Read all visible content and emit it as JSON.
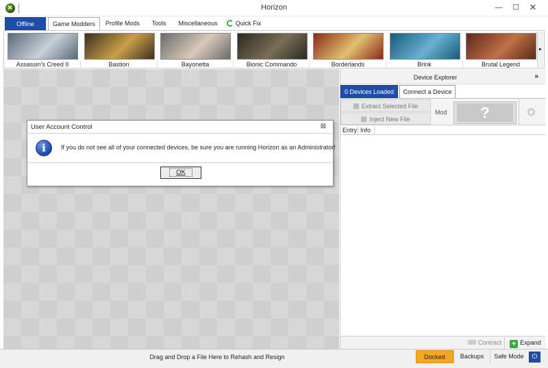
{
  "window": {
    "title": "Horizon",
    "min_glyph": "—",
    "max_glyph": "☐",
    "close_glyph": "✕"
  },
  "tabs": {
    "offline": "Offline",
    "game_modders": "Game Modders",
    "profile_mods": "Profile Mods",
    "tools": "Tools",
    "miscellaneous": "Miscellaneous",
    "quick_fix": "Quick Fix"
  },
  "games": [
    {
      "label": "Assassin's Creed II",
      "colors": [
        "#5a6a7a",
        "#c8d0d8"
      ]
    },
    {
      "label": "Bastion",
      "colors": [
        "#3e2f1f",
        "#c9a04a"
      ]
    },
    {
      "label": "Bayonetta",
      "colors": [
        "#6b6b6b",
        "#d8c9b8"
      ]
    },
    {
      "label": "Bionic Commando",
      "colors": [
        "#2a2a22",
        "#7a6e54"
      ]
    },
    {
      "label": "Borderlands",
      "colors": [
        "#8a2a1a",
        "#e0c070"
      ]
    },
    {
      "label": "Brink",
      "colors": [
        "#1a5a7a",
        "#6ab0d0"
      ]
    },
    {
      "label": "Brutal Legend",
      "colors": [
        "#5a2a1a",
        "#c07048"
      ]
    }
  ],
  "gallery_next_glyph": "▸",
  "dialog": {
    "title": "User Account Control",
    "close_glyph": "⊠",
    "info_glyph": "i",
    "message": "If you do not see all of your connected devices, be sure you are running Horizon as an Administrator!",
    "ok_label": "OK"
  },
  "explorer": {
    "title": "Device Explorer",
    "collapse_glyph": "»",
    "tab_devices_loaded": "0 Devices Loaded",
    "tab_connect_device": "Connect a Device",
    "extract_label": "Extract Selected File",
    "inject_label": "Inject New File",
    "mod_label": "Mod",
    "mod_placeholder": "?",
    "columns": [
      "Entry",
      "Info"
    ],
    "contract_label": "Contract",
    "expand_label": "Expand",
    "expand_glyph": "+"
  },
  "statusbar": {
    "text": "Drag and Drop a File Here to Rehash and Resign",
    "docked": "Docked",
    "backups": "Backups",
    "safe_mode": "Safe Mode",
    "power_glyph": "⏻"
  },
  "colors": {
    "accent": "#1d4ea9",
    "docked": "#f5a623",
    "expand_green": "#3aa83a"
  }
}
